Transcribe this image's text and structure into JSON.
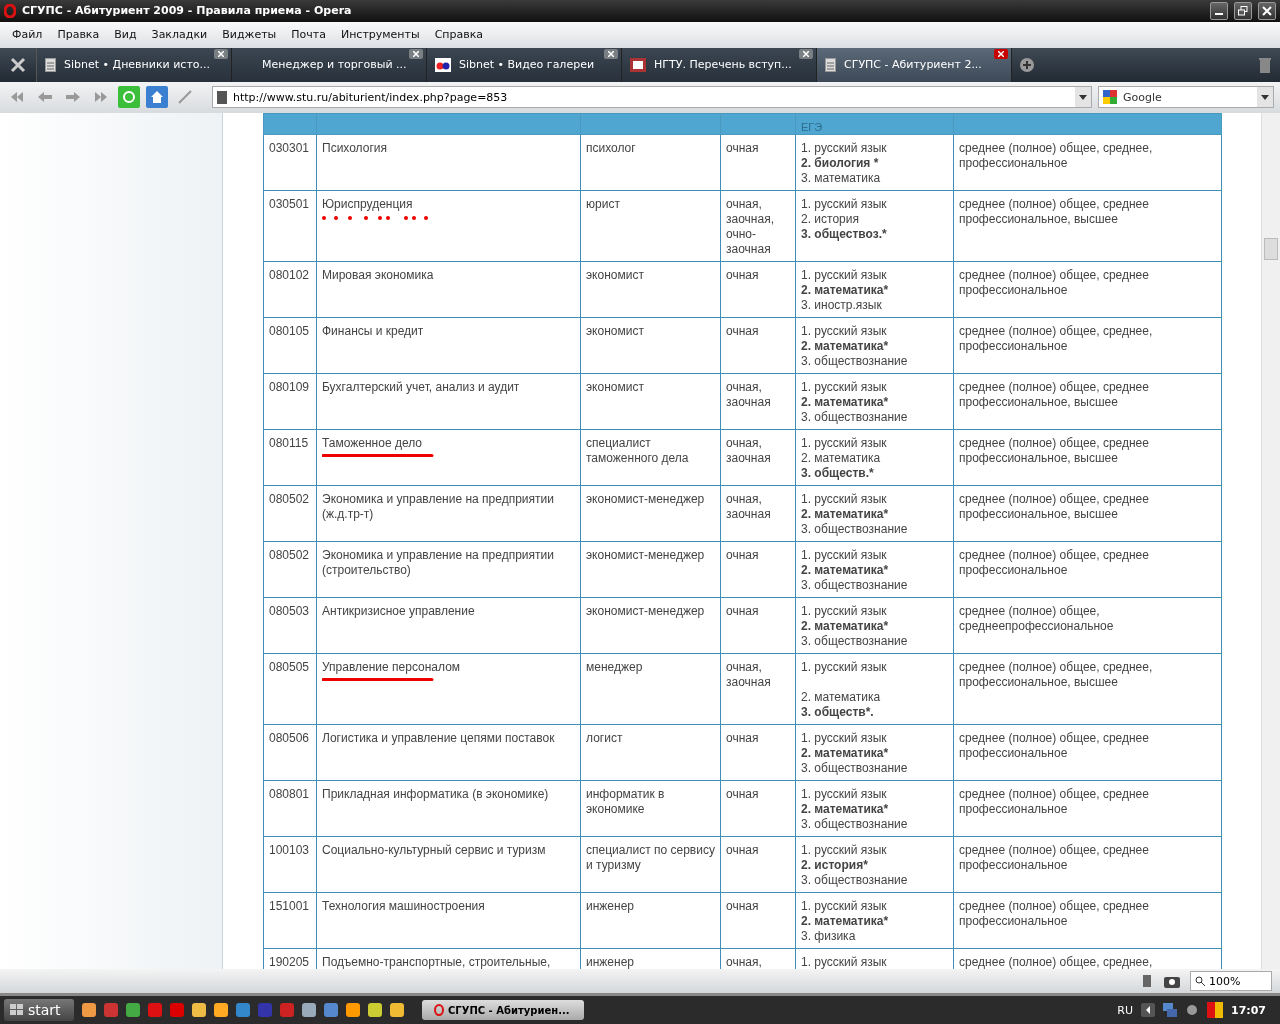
{
  "window": {
    "title": "СГУПС - Абитуриент 2009 - Правила приема - Opera"
  },
  "menu": [
    "Файл",
    "Правка",
    "Вид",
    "Закладки",
    "Виджеты",
    "Почта",
    "Инструменты",
    "Справка"
  ],
  "tabs": [
    {
      "label": "Sibnet • Дневники исто...",
      "kind": "page",
      "selected": false
    },
    {
      "label": "Менеджер и торговый ...",
      "kind": "blank",
      "selected": false
    },
    {
      "label": "Sibnet • Видео галереи",
      "kind": "video",
      "selected": false
    },
    {
      "label": "НГТУ. Перечень вступ...",
      "kind": "site",
      "selected": false
    },
    {
      "label": "СГУПС - Абитуриент 2...",
      "kind": "page",
      "selected": true
    }
  ],
  "address": {
    "url": "http://www.stu.ru/abiturient/index.php?page=853"
  },
  "search": {
    "engine": "Google"
  },
  "table": {
    "header": {
      "column_5": "ЕГЭ"
    },
    "rows": [
      {
        "code": "030301",
        "name": "Психология",
        "qualification": "психолог",
        "form": "очная",
        "exams": [
          {
            "text": "1. русский язык",
            "bold": false
          },
          {
            "text": "2. биология *",
            "bold": true
          },
          {
            "text": "3. математика",
            "bold": false
          }
        ],
        "education": "среднее (полное) общее, среднее, профессиональное"
      },
      {
        "code": "030501",
        "name": "Юриспруденция",
        "kind": "dotted",
        "qualification": "юрист",
        "form": "очная, заочная, очно-заочная",
        "exams": [
          {
            "text": "1. русский язык",
            "bold": false
          },
          {
            "text": "2. история",
            "bold": false
          },
          {
            "text": "3. обществоз.*",
            "bold": true
          }
        ],
        "education": "среднее (полное) общее, среднее профессиональное, высшее"
      },
      {
        "code": "080102",
        "name": "Мировая экономика",
        "qualification": "экономист",
        "form": "очная",
        "exams": [
          {
            "text": "1. русский язык",
            "bold": false
          },
          {
            "text": "2. математика*",
            "bold": true
          },
          {
            "text": "3. иностр.язык",
            "bold": false
          }
        ],
        "education": "среднее (полное) общее, среднее профессиональное"
      },
      {
        "code": "080105",
        "name": "Финансы и кредит",
        "qualification": "экономист",
        "form": "очная",
        "exams": [
          {
            "text": "1. русский язык",
            "bold": false
          },
          {
            "text": "2. математика*",
            "bold": true
          },
          {
            "text": "3. обществознание",
            "bold": false
          }
        ],
        "education": "среднее (полное) общее, среднее, профессиональное"
      },
      {
        "code": "080109",
        "name": "Бухгалтерский учет, анализ и аудит",
        "qualification": "экономист",
        "form": "очная, заочная",
        "exams": [
          {
            "text": "1. русский язык",
            "bold": false
          },
          {
            "text": "2. математика*",
            "bold": true
          },
          {
            "text": "3. обществознание",
            "bold": false
          }
        ],
        "education": "среднее (полное) общее, среднее профессиональное, высшее"
      },
      {
        "code": "080115",
        "name": "Таможенное дело",
        "kind": "underlined",
        "qualification": "специалист таможенного дела",
        "form": "очная, заочная",
        "exams": [
          {
            "text": "1. русский язык",
            "bold": false
          },
          {
            "text": "2. математика",
            "bold": false
          },
          {
            "text": "3. обществ.*",
            "bold": true
          }
        ],
        "education": "среднее (полное) общее, среднее профессиональное, высшее"
      },
      {
        "code": "080502",
        "name": "Экономика и управление на предприятии (ж.д.тр-т)",
        "qualification": "экономист-менеджер",
        "form": "очная, заочная",
        "exams": [
          {
            "text": "1. русский язык",
            "bold": false
          },
          {
            "text": "2. математика*",
            "bold": true
          },
          {
            "text": "3. обществознание",
            "bold": false
          }
        ],
        "education": "среднее (полное) общее, среднее профессиональное, высшее"
      },
      {
        "code": "080502",
        "name": "Экономика и управление на предприятии (строительство)",
        "qualification": "экономист-менеджер",
        "form": "очная",
        "exams": [
          {
            "text": "1. русский язык",
            "bold": false
          },
          {
            "text": "2. математика*",
            "bold": true
          },
          {
            "text": "3. обществознание",
            "bold": false
          }
        ],
        "education": "среднее (полное) общее, среднее профессиональное"
      },
      {
        "code": "080503",
        "name": "Антикризисное управление",
        "qualification": "экономист-менеджер",
        "form": "очная",
        "exams": [
          {
            "text": "1. русский язык",
            "bold": false
          },
          {
            "text": "2. математика*",
            "bold": true
          },
          {
            "text": "3. обществознание",
            "bold": false
          }
        ],
        "education": "среднее (полное) общее, среднеепрофессиональное"
      },
      {
        "code": "080505",
        "name": "Управление персоналом",
        "kind": "underlined",
        "qualification": "менеджер",
        "form": "очная, заочная",
        "exams": [
          {
            "text": "1. русский язык",
            "bold": false
          },
          {
            "text": "2. математика",
            "bold": false,
            "spaced": true
          },
          {
            "text": "3. обществ*.",
            "bold": true
          }
        ],
        "education": "среднее (полное) общее, среднее, профессиональное, высшее"
      },
      {
        "code": "080506",
        "name": "Логистика и управление цепями поставок",
        "qualification": "логист",
        "form": "очная",
        "exams": [
          {
            "text": "1. русский язык",
            "bold": false
          },
          {
            "text": "2. математика*",
            "bold": true
          },
          {
            "text": "3. обществознание",
            "bold": false
          }
        ],
        "education": "среднее (полное) общее, среднее профессиональное"
      },
      {
        "code": "080801",
        "name": "Прикладная информатика (в экономике)",
        "qualification": "информатик в экономике",
        "form": "очная",
        "exams": [
          {
            "text": "1. русский язык",
            "bold": false
          },
          {
            "text": "2. математика*",
            "bold": true
          },
          {
            "text": "3. обществознание",
            "bold": false
          }
        ],
        "education": "среднее (полное) общее, среднее профессиональное"
      },
      {
        "code": "100103",
        "name": "Социально-культурный сервис и туризм",
        "qualification": "специалист по сервису и туризму",
        "form": "очная",
        "exams": [
          {
            "text": "1. русский язык",
            "bold": false
          },
          {
            "text": "2. история*",
            "bold": true
          },
          {
            "text": "3. обществознание",
            "bold": false
          }
        ],
        "education": "среднее (полное) общее, среднее профессиональное"
      },
      {
        "code": "151001",
        "name": "Технология машиностроения",
        "qualification": "инженер",
        "form": "очная",
        "exams": [
          {
            "text": "1. русский язык",
            "bold": false
          },
          {
            "text": "2. математика*",
            "bold": true
          },
          {
            "text": "3. физика",
            "bold": false
          }
        ],
        "education": "среднее (полное) общее, среднее профессиональное"
      },
      {
        "code": "190205",
        "name": "Подъемно-транспортные, строительные,",
        "qualification": "инженер",
        "form": "очная,",
        "exams": [
          {
            "text": "1. русский язык",
            "bold": false
          }
        ],
        "education": "среднее (полное) общее, среднее,"
      }
    ]
  },
  "status_bar": {
    "zoom": "100%"
  },
  "taskbar": {
    "start": "start",
    "task": "СГУПС - Абитуриен...",
    "language": "RU",
    "clock": "17:07"
  }
}
